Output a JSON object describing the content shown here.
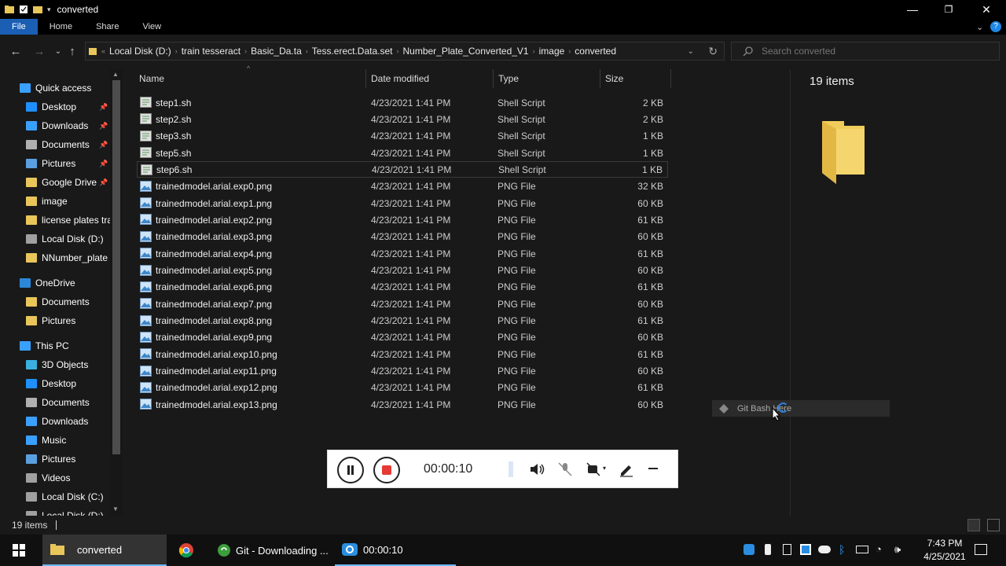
{
  "window": {
    "title": "converted",
    "controls": {
      "minimize": "—",
      "maximize": "❐",
      "close": "✕"
    }
  },
  "ribbon": {
    "tabs": [
      {
        "label": "File",
        "active": true
      },
      {
        "label": "Home"
      },
      {
        "label": "Share"
      },
      {
        "label": "View"
      }
    ]
  },
  "address": {
    "crumbs": [
      "Local Disk (D:)",
      "train tesseract",
      "Basic_Da.ta",
      "Tess.erect.Data.set",
      "Number_Plate_Converted_V1",
      "image",
      "converted"
    ],
    "overflow": "«"
  },
  "search": {
    "placeholder": "Search converted"
  },
  "sidebar": {
    "items": [
      {
        "label": "Quick access",
        "icon": "star-icon",
        "color": "#3aa0ff",
        "indent": 0
      },
      {
        "label": "Desktop",
        "icon": "desktop-icon",
        "color": "#1e90ff",
        "indent": 1,
        "pinned": true
      },
      {
        "label": "Downloads",
        "icon": "download-icon",
        "color": "#3aa0ff",
        "indent": 1,
        "pinned": true
      },
      {
        "label": "Documents",
        "icon": "documents-icon",
        "color": "#b0b0b0",
        "indent": 1,
        "pinned": true
      },
      {
        "label": "Pictures",
        "icon": "pictures-icon",
        "color": "#5aa0e0",
        "indent": 1,
        "pinned": true
      },
      {
        "label": "Google Drive",
        "icon": "folder-icon",
        "color": "#e8c65a",
        "indent": 1,
        "pinned": true
      },
      {
        "label": "image",
        "icon": "folder-icon",
        "color": "#e8c65a",
        "indent": 1
      },
      {
        "label": "license plates tra",
        "icon": "folder-icon",
        "color": "#e8c65a",
        "indent": 1
      },
      {
        "label": "Local Disk (D:)",
        "icon": "drive-icon",
        "color": "#a0a0a0",
        "indent": 1
      },
      {
        "label": "NNumber_plate",
        "icon": "folder-icon",
        "color": "#e8c65a",
        "indent": 1
      },
      {
        "label": "OneDrive",
        "icon": "cloud-icon",
        "color": "#2b88d8",
        "indent": 0
      },
      {
        "label": "Documents",
        "icon": "folder-icon",
        "color": "#e8c65a",
        "indent": 1
      },
      {
        "label": "Pictures",
        "icon": "folder-icon",
        "color": "#e8c65a",
        "indent": 1
      },
      {
        "label": "This PC",
        "icon": "pc-icon",
        "color": "#3aa0ff",
        "indent": 0
      },
      {
        "label": "3D Objects",
        "icon": "cube-icon",
        "color": "#3ab0e0",
        "indent": 1
      },
      {
        "label": "Desktop",
        "icon": "desktop-icon",
        "color": "#1e90ff",
        "indent": 1
      },
      {
        "label": "Documents",
        "icon": "documents-icon",
        "color": "#b0b0b0",
        "indent": 1
      },
      {
        "label": "Downloads",
        "icon": "download-icon",
        "color": "#3aa0ff",
        "indent": 1
      },
      {
        "label": "Music",
        "icon": "music-icon",
        "color": "#3aa0ff",
        "indent": 1
      },
      {
        "label": "Pictures",
        "icon": "pictures-icon",
        "color": "#5aa0e0",
        "indent": 1
      },
      {
        "label": "Videos",
        "icon": "video-icon",
        "color": "#a0a0a0",
        "indent": 1
      },
      {
        "label": "Local Disk (C:)",
        "icon": "drive-icon",
        "color": "#a0a0a0",
        "indent": 1
      },
      {
        "label": "Local Disk (D:)",
        "icon": "drive-icon",
        "color": "#a0a0a0",
        "indent": 1
      }
    ]
  },
  "columns": {
    "name": "Name",
    "date": "Date modified",
    "type": "Type",
    "size": "Size"
  },
  "files": [
    {
      "name": "step1.sh",
      "date": "4/23/2021 1:41 PM",
      "type": "Shell Script",
      "size": "2 KB",
      "kind": "script"
    },
    {
      "name": "step2.sh",
      "date": "4/23/2021 1:41 PM",
      "type": "Shell Script",
      "size": "2 KB",
      "kind": "script"
    },
    {
      "name": "step3.sh",
      "date": "4/23/2021 1:41 PM",
      "type": "Shell Script",
      "size": "1 KB",
      "kind": "script"
    },
    {
      "name": "step5.sh",
      "date": "4/23/2021 1:41 PM",
      "type": "Shell Script",
      "size": "1 KB",
      "kind": "script"
    },
    {
      "name": "step6.sh",
      "date": "4/23/2021 1:41 PM",
      "type": "Shell Script",
      "size": "1 KB",
      "kind": "script",
      "selected": true
    },
    {
      "name": "trainedmodel.arial.exp0.png",
      "date": "4/23/2021 1:41 PM",
      "type": "PNG File",
      "size": "32 KB",
      "kind": "png"
    },
    {
      "name": "trainedmodel.arial.exp1.png",
      "date": "4/23/2021 1:41 PM",
      "type": "PNG File",
      "size": "60 KB",
      "kind": "png"
    },
    {
      "name": "trainedmodel.arial.exp2.png",
      "date": "4/23/2021 1:41 PM",
      "type": "PNG File",
      "size": "61 KB",
      "kind": "png"
    },
    {
      "name": "trainedmodel.arial.exp3.png",
      "date": "4/23/2021 1:41 PM",
      "type": "PNG File",
      "size": "60 KB",
      "kind": "png"
    },
    {
      "name": "trainedmodel.arial.exp4.png",
      "date": "4/23/2021 1:41 PM",
      "type": "PNG File",
      "size": "61 KB",
      "kind": "png"
    },
    {
      "name": "trainedmodel.arial.exp5.png",
      "date": "4/23/2021 1:41 PM",
      "type": "PNG File",
      "size": "60 KB",
      "kind": "png"
    },
    {
      "name": "trainedmodel.arial.exp6.png",
      "date": "4/23/2021 1:41 PM",
      "type": "PNG File",
      "size": "61 KB",
      "kind": "png"
    },
    {
      "name": "trainedmodel.arial.exp7.png",
      "date": "4/23/2021 1:41 PM",
      "type": "PNG File",
      "size": "60 KB",
      "kind": "png"
    },
    {
      "name": "trainedmodel.arial.exp8.png",
      "date": "4/23/2021 1:41 PM",
      "type": "PNG File",
      "size": "61 KB",
      "kind": "png"
    },
    {
      "name": "trainedmodel.arial.exp9.png",
      "date": "4/23/2021 1:41 PM",
      "type": "PNG File",
      "size": "60 KB",
      "kind": "png"
    },
    {
      "name": "trainedmodel.arial.exp10.png",
      "date": "4/23/2021 1:41 PM",
      "type": "PNG File",
      "size": "61 KB",
      "kind": "png"
    },
    {
      "name": "trainedmodel.arial.exp11.png",
      "date": "4/23/2021 1:41 PM",
      "type": "PNG File",
      "size": "60 KB",
      "kind": "png"
    },
    {
      "name": "trainedmodel.arial.exp12.png",
      "date": "4/23/2021 1:41 PM",
      "type": "PNG File",
      "size": "61 KB",
      "kind": "png"
    },
    {
      "name": "trainedmodel.arial.exp13.png",
      "date": "4/23/2021 1:41 PM",
      "type": "PNG File",
      "size": "60 KB",
      "kind": "png"
    }
  ],
  "preview": {
    "count": "19 items"
  },
  "status": {
    "count": "19 items"
  },
  "context_menu": {
    "label": "Git Bash Here"
  },
  "recorder": {
    "time": "00:00:10"
  },
  "taskbar": {
    "items": [
      {
        "label": "converted",
        "icon": "folder-icon",
        "active": true
      },
      {
        "label": "",
        "icon": "chrome-icon"
      },
      {
        "label": "Git - Downloading ...",
        "icon": "git-icon"
      },
      {
        "label": "00:00:10",
        "icon": "recorder-icon"
      }
    ],
    "clock_time": "7:43 PM",
    "clock_date": "4/25/2021"
  },
  "colors": {
    "accent": "#1a5fb4",
    "folder": "#e8c65a",
    "record_red": "#e53935"
  }
}
